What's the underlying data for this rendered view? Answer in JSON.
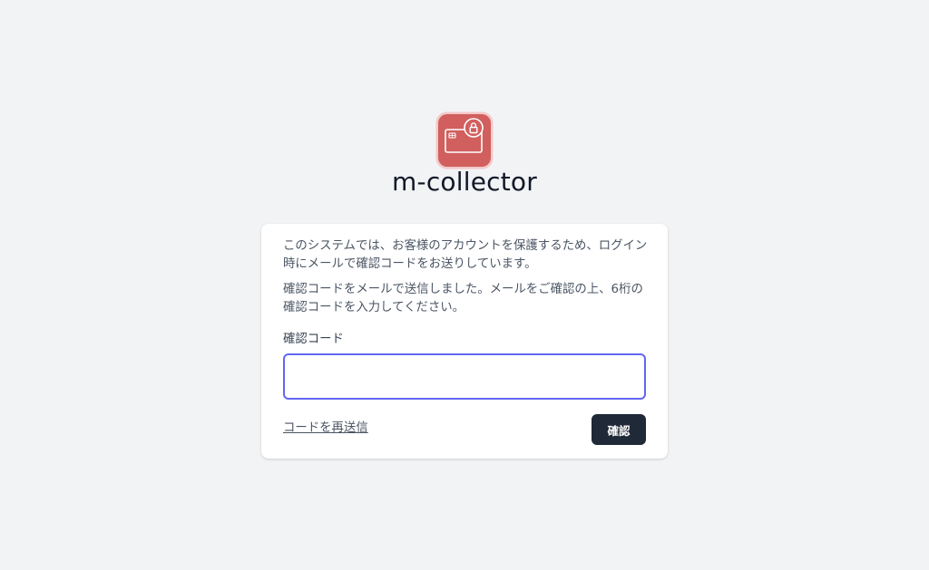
{
  "app": {
    "name": "m-collector",
    "logo_icon": "card-lock-icon",
    "logo_color": "#d15f5e"
  },
  "card": {
    "paragraph_1": "このシステムでは、お客様のアカウントを保護するため、ログイン時にメールで確認コードをお送りしています。",
    "paragraph_2": "確認コードをメールで送信しました。メールをご確認の上、6桁の確認コードを入力してください。",
    "code_label": "確認コード",
    "code_value": "",
    "code_placeholder": "",
    "resend_label": "コードを再送信",
    "confirm_label": "確認"
  },
  "colors": {
    "background": "#f2f3f5",
    "input_focus_border": "#6366f1",
    "button_bg": "#1f2937"
  }
}
